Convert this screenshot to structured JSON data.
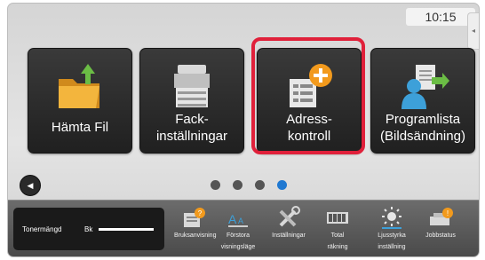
{
  "status": {
    "time": "10:15"
  },
  "tiles": [
    {
      "label": "Hämta Fil",
      "icon": "folder-download-icon"
    },
    {
      "label": "Fack-\ninställningar",
      "icon": "printer-icon"
    },
    {
      "label": "Adress-\nkontroll",
      "icon": "address-list-add-icon"
    },
    {
      "label": "Programlista\n(Bildsändning)",
      "icon": "person-document-send-icon"
    }
  ],
  "pager": {
    "pages": 4,
    "current": 4
  },
  "toner": {
    "label": "Tonermängd",
    "color": "Bk",
    "level": 1.0
  },
  "system_items": [
    {
      "label": "Bruksanvisning",
      "icon": "manual-icon"
    },
    {
      "label": "Förstora\nvisningsläge",
      "icon": "enlarge-text-icon"
    },
    {
      "label": "Inställningar",
      "icon": "tools-icon"
    },
    {
      "label": "Total\nräkning",
      "icon": "counter-icon"
    },
    {
      "label": "Ljusstyrka\ninställning",
      "icon": "brightness-icon"
    },
    {
      "label": "Jobbstatus",
      "icon": "job-status-icon"
    }
  ],
  "colors": {
    "highlight": "#e0203a",
    "active_dot": "#1f78d1",
    "accent_orange": "#f29a1d",
    "accent_green": "#6bbd45"
  }
}
